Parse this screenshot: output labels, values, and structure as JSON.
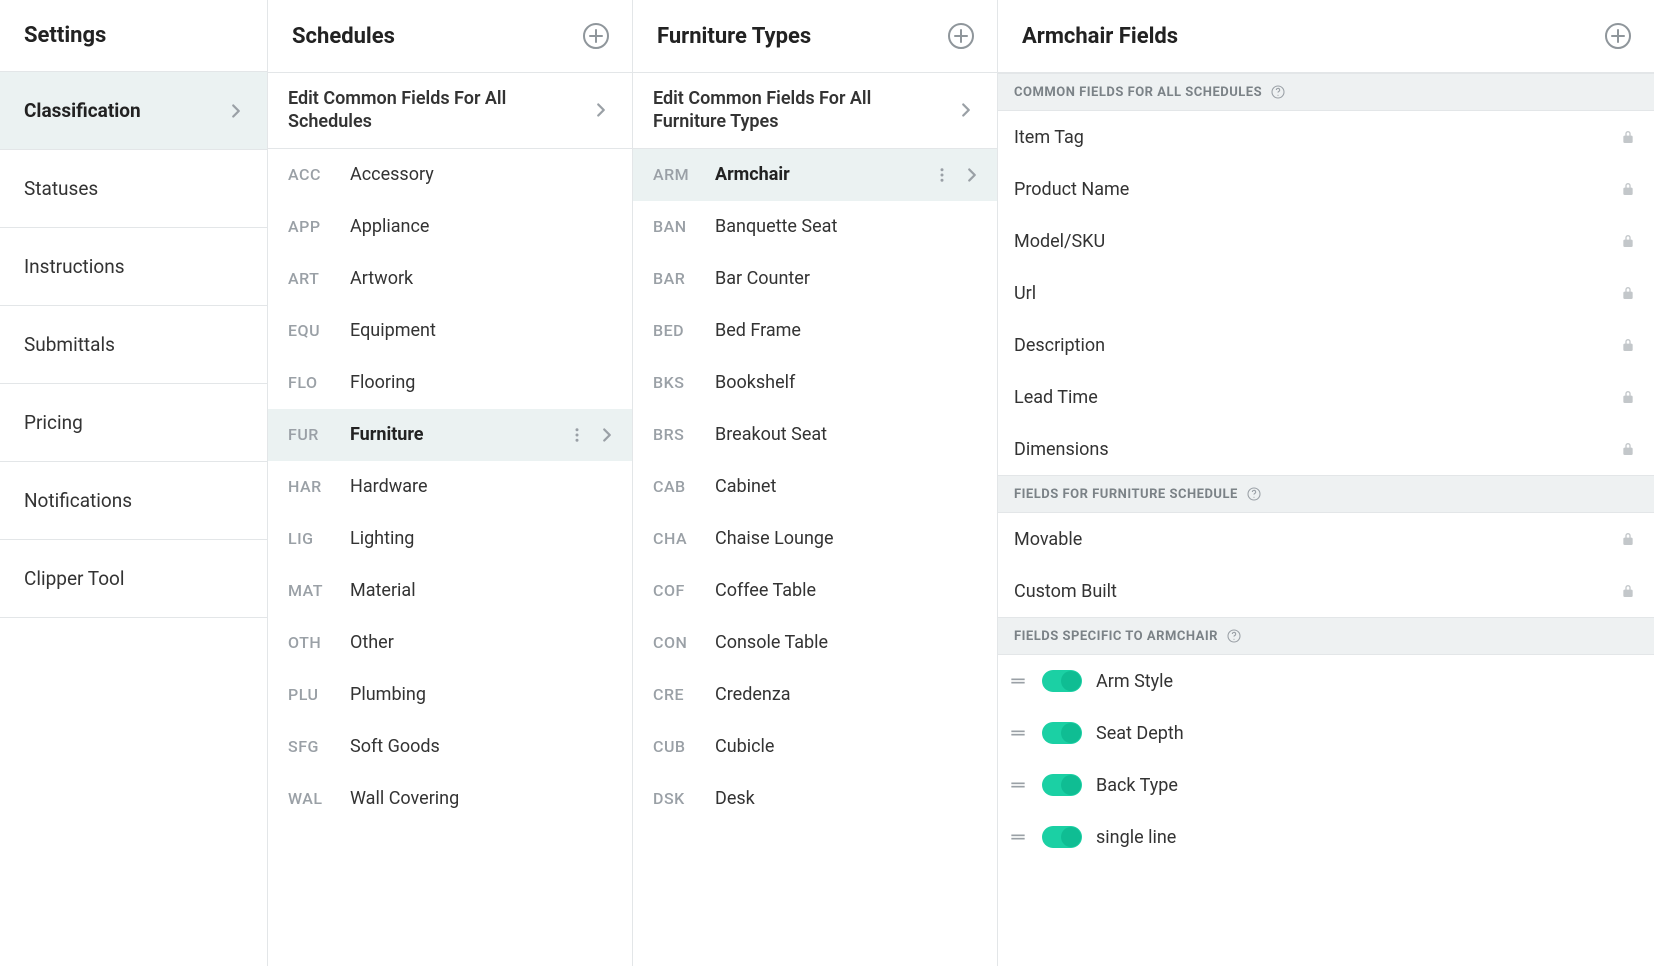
{
  "settings": {
    "title": "Settings",
    "items": [
      {
        "label": "Classification",
        "active": true
      },
      {
        "label": "Statuses"
      },
      {
        "label": "Instructions"
      },
      {
        "label": "Submittals"
      },
      {
        "label": "Pricing"
      },
      {
        "label": "Notifications"
      },
      {
        "label": "Clipper Tool"
      }
    ]
  },
  "schedules": {
    "title": "Schedules",
    "editCommon": "Edit Common Fields For All Schedules",
    "items": [
      {
        "code": "ACC",
        "name": "Accessory"
      },
      {
        "code": "APP",
        "name": "Appliance"
      },
      {
        "code": "ART",
        "name": "Artwork"
      },
      {
        "code": "EQU",
        "name": "Equipment"
      },
      {
        "code": "FLO",
        "name": "Flooring"
      },
      {
        "code": "FUR",
        "name": "Furniture",
        "active": true
      },
      {
        "code": "HAR",
        "name": "Hardware"
      },
      {
        "code": "LIG",
        "name": "Lighting"
      },
      {
        "code": "MAT",
        "name": "Material"
      },
      {
        "code": "OTH",
        "name": "Other"
      },
      {
        "code": "PLU",
        "name": "Plumbing"
      },
      {
        "code": "SFG",
        "name": "Soft Goods"
      },
      {
        "code": "WAL",
        "name": "Wall Covering"
      }
    ]
  },
  "types": {
    "title": "Furniture Types",
    "editCommon": "Edit Common Fields For All Furniture Types",
    "items": [
      {
        "code": "ARM",
        "name": "Armchair",
        "active": true
      },
      {
        "code": "BAN",
        "name": "Banquette Seat"
      },
      {
        "code": "BAR",
        "name": "Bar Counter"
      },
      {
        "code": "BED",
        "name": "Bed Frame"
      },
      {
        "code": "BKS",
        "name": "Bookshelf"
      },
      {
        "code": "BRS",
        "name": "Breakout Seat"
      },
      {
        "code": "CAB",
        "name": "Cabinet"
      },
      {
        "code": "CHA",
        "name": "Chaise Lounge"
      },
      {
        "code": "COF",
        "name": "Coffee Table"
      },
      {
        "code": "CON",
        "name": "Console Table"
      },
      {
        "code": "CRE",
        "name": "Credenza"
      },
      {
        "code": "CUB",
        "name": "Cubicle"
      },
      {
        "code": "DSK",
        "name": "Desk"
      }
    ]
  },
  "fields": {
    "title": "Armchair Fields",
    "sections": [
      {
        "label": "COMMON FIELDS FOR ALL SCHEDULES",
        "fields": [
          {
            "name": "Item Tag",
            "locked": true
          },
          {
            "name": "Product Name",
            "locked": true
          },
          {
            "name": "Model/SKU",
            "locked": true
          },
          {
            "name": "Url",
            "locked": true
          },
          {
            "name": "Description",
            "locked": true
          },
          {
            "name": "Lead Time",
            "locked": true
          },
          {
            "name": "Dimensions",
            "locked": true
          }
        ]
      },
      {
        "label": "FIELDS FOR FURNITURE SCHEDULE",
        "fields": [
          {
            "name": "Movable",
            "locked": true
          },
          {
            "name": "Custom Built",
            "locked": true
          }
        ]
      },
      {
        "label": "FIELDS SPECIFIC TO ARMCHAIR",
        "fields": [
          {
            "name": "Arm Style",
            "toggle": true,
            "on": true
          },
          {
            "name": "Seat Depth",
            "toggle": true,
            "on": true
          },
          {
            "name": "Back Type",
            "toggle": true,
            "on": true
          },
          {
            "name": "single line",
            "toggle": true,
            "on": true
          }
        ]
      }
    ]
  }
}
